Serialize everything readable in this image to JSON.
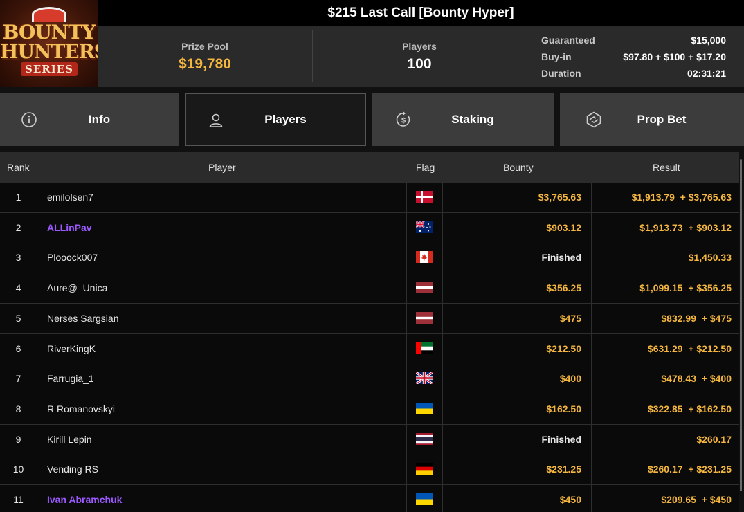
{
  "header": {
    "logo_line1": "BOUNTY",
    "logo_line2": "HUNTERS",
    "logo_line3": "SERIES",
    "title": "$215 Last Call [Bounty Hyper]",
    "prize_pool_label": "Prize Pool",
    "prize_pool_value": "$19,780",
    "players_label": "Players",
    "players_value": "100",
    "details": [
      {
        "label": "Guaranteed",
        "value": "$15,000"
      },
      {
        "label": "Buy-in",
        "value": "$97.80 + $100 + $17.20"
      },
      {
        "label": "Duration",
        "value": "02:31:21"
      }
    ]
  },
  "tabs": [
    {
      "label": "Info",
      "icon": "info-icon",
      "active": false
    },
    {
      "label": "Players",
      "icon": "user-icon",
      "active": true
    },
    {
      "label": "Staking",
      "icon": "dollar-cycle-icon",
      "active": false
    },
    {
      "label": "Prop Bet",
      "icon": "prop-bet-icon",
      "active": false
    }
  ],
  "table": {
    "columns": [
      "Rank",
      "Player",
      "Flag",
      "Bounty",
      "Result"
    ],
    "rows": [
      {
        "rank": "1",
        "player": "emilolsen7",
        "highlight": false,
        "flag": "dk-flag",
        "bounty": "$3,765.63",
        "result": "$1,913.79  + $3,765.63"
      },
      {
        "rank": "2",
        "player": "ALLinPav",
        "highlight": true,
        "flag": "au-flag",
        "bounty": "$903.12",
        "result": "$1,913.73  + $903.12"
      },
      {
        "rank": "3",
        "player": "Plooock007",
        "highlight": false,
        "flag": "ca-flag",
        "bounty": "Finished",
        "result": "$1,450.33"
      },
      {
        "rank": "4",
        "player": "Aure@_Unica",
        "highlight": false,
        "flag": "lv-flag",
        "bounty": "$356.25",
        "result": "$1,099.15  + $356.25"
      },
      {
        "rank": "5",
        "player": "Nerses Sargsian",
        "highlight": false,
        "flag": "lv-flag",
        "bounty": "$475",
        "result": "$832.99  + $475"
      },
      {
        "rank": "6",
        "player": "RiverKingK",
        "highlight": false,
        "flag": "ae-flag",
        "bounty": "$212.50",
        "result": "$631.29  + $212.50"
      },
      {
        "rank": "7",
        "player": "Farrugia_1",
        "highlight": false,
        "flag": "gb-flag",
        "bounty": "$400",
        "result": "$478.43  + $400"
      },
      {
        "rank": "8",
        "player": "R Romanovskyi",
        "highlight": false,
        "flag": "ua-flag",
        "bounty": "$162.50",
        "result": "$322.85  + $162.50"
      },
      {
        "rank": "9",
        "player": "Kirill Lepin",
        "highlight": false,
        "flag": "th-flag",
        "bounty": "Finished",
        "result": "$260.17"
      },
      {
        "rank": "10",
        "player": "Vending RS",
        "highlight": false,
        "flag": "de-flag",
        "bounty": "$231.25",
        "result": "$260.17  + $231.25"
      },
      {
        "rank": "11",
        "player": "Ivan Abramchuk",
        "highlight": true,
        "flag": "ua-flag",
        "bounty": "$450",
        "result": "$209.65  + $450"
      }
    ]
  },
  "colors": {
    "gold": "#f4b63f",
    "purple": "#9b59ff",
    "tab_bg": "#3c3c3c",
    "tab_active_bg": "#191919"
  }
}
